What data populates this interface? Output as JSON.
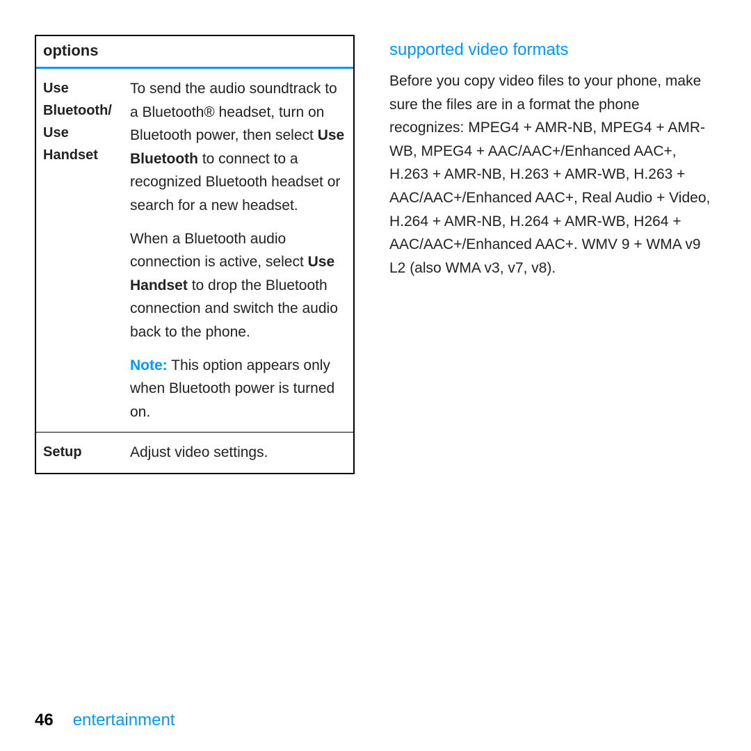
{
  "table": {
    "title": "options",
    "rows": [
      {
        "label_line1": "Use Bluetooth/",
        "label_line2": "Use Handset",
        "desc": {
          "p1_a": "To send the audio soundtrack to a Bluetooth® headset, turn on Bluetooth power, then select ",
          "p1_bold1": "Use Bluetooth",
          "p1_b": " to connect to a recognized Bluetooth headset or search for a new headset.",
          "p2_a": "When a Bluetooth audio connection is active, select ",
          "p2_bold1": "Use Handset",
          "p2_b": " to drop the Bluetooth connection and switch the audio back to the phone.",
          "p3_note": "Note:",
          "p3_rest": " This option appears only when Bluetooth power is turned on."
        }
      },
      {
        "label_line1": "Setup",
        "desc_simple": "Adjust video settings."
      }
    ]
  },
  "right": {
    "heading": "supported video formats",
    "body": "Before you copy video files to your phone, make sure the files are in a format the phone recognizes: MPEG4 + AMR-NB, MPEG4 + AMR-WB, MPEG4 + AAC/AAC+/Enhanced AAC+, H.263 + AMR-NB, H.263 + AMR-WB, H.263 + AAC/AAC+/Enhanced AAC+, Real Audio + Video, H.264 + AMR-NB, H.264 + AMR-WB, H264 + AAC/AAC+/Enhanced AAC+. WMV 9 + WMA v9 L2 (also WMA v3, v7, v8)."
  },
  "footer": {
    "pageNumber": "46",
    "section": "entertainment"
  }
}
